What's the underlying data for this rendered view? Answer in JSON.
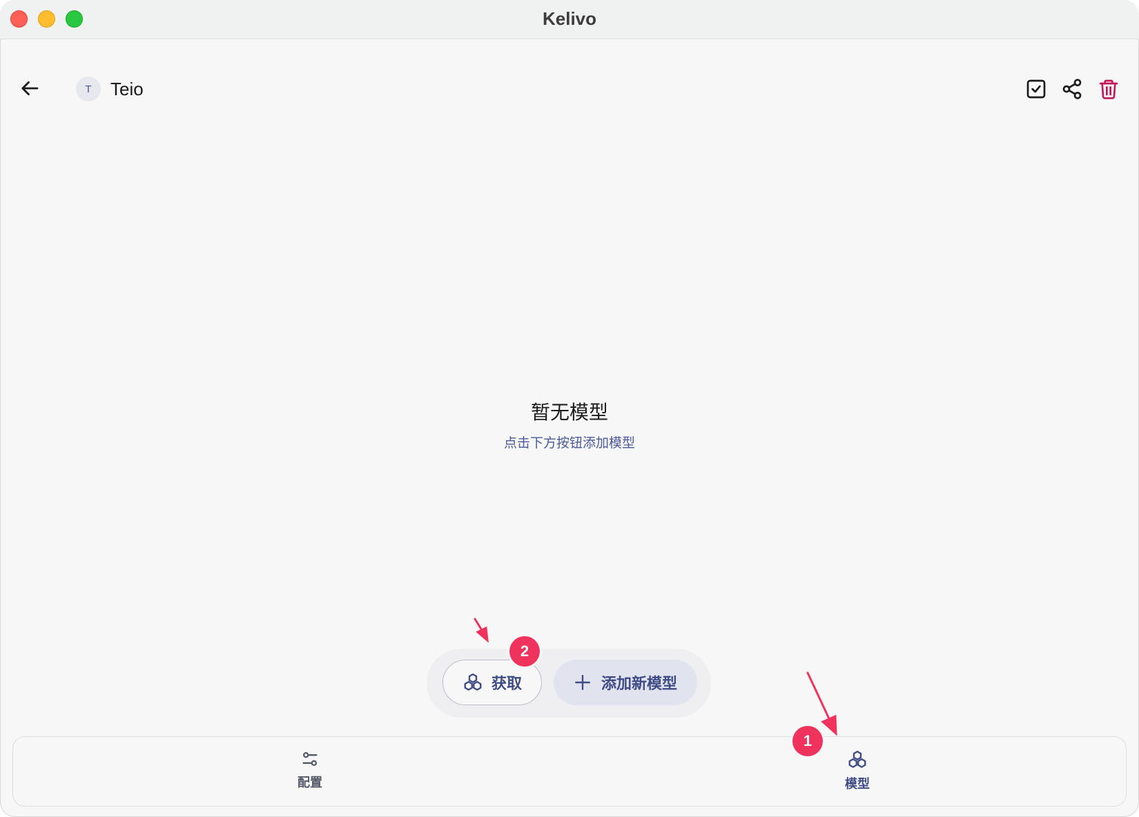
{
  "window": {
    "title": "Kelivo"
  },
  "header": {
    "avatar_letter": "T",
    "provider_name": "Teio"
  },
  "empty_state": {
    "title": "暂无模型",
    "subtitle": "点击下方按钮添加模型"
  },
  "actions": {
    "fetch_label": "获取",
    "add_label": "添加新模型"
  },
  "bottom_nav": {
    "items": [
      {
        "label": "配置",
        "icon": "sliders-icon",
        "active": false
      },
      {
        "label": "模型",
        "icon": "models-icon",
        "active": true
      }
    ]
  },
  "annotations": {
    "badge_1": "1",
    "badge_2": "2",
    "color": "#f0335c"
  },
  "colors": {
    "accent": "#3f4c86",
    "danger": "#c2185b",
    "background": "#f7f7f7"
  }
}
